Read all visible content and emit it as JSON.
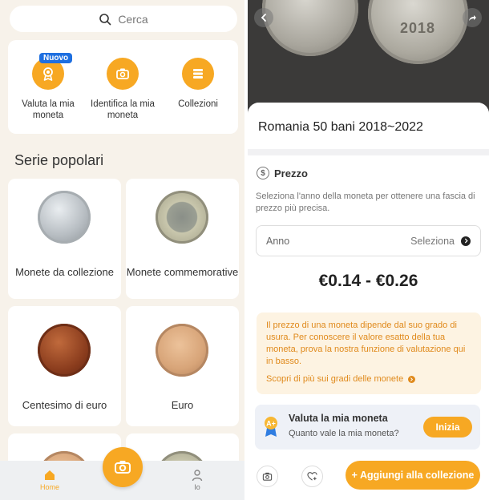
{
  "left_screen": {
    "search": {
      "placeholder": "Cerca",
      "icon": "search-icon"
    },
    "quick_actions": [
      {
        "label": "Valuta la mia moneta",
        "badge": "Nuovo",
        "icon": "medal-icon"
      },
      {
        "label": "Identifica la mia moneta",
        "icon": "camera-icon"
      },
      {
        "label": "Collezioni",
        "icon": "stack-icon"
      }
    ],
    "section_title": "Serie popolari",
    "series": [
      {
        "label": "Monete da collezione"
      },
      {
        "label": "Monete commemorative"
      },
      {
        "label": "Centesimo di euro"
      },
      {
        "label": "Euro"
      }
    ],
    "bottom_nav": {
      "home": "Home",
      "profile": "Io"
    }
  },
  "right_screen": {
    "photo_year_text": "2018",
    "coin_title": "Romania 50 bani 2018~2022",
    "price_section": {
      "heading": "Prezzo",
      "hint": "Seleziona l'anno della moneta per ottenere una fascia di prezzo più precisa.",
      "year_field_label": "Anno",
      "year_field_action": "Seleziona",
      "price_range": "€0.14 - €0.26"
    },
    "note": {
      "text": "Il prezzo di una moneta dipende dal suo grado di usura. Per conoscere il valore esatto della tua moneta, prova la nostra funzione di valutazione qui in basso.",
      "link": "Scopri di più sui gradi delle monete"
    },
    "valuta_card": {
      "title": "Valuta la mia moneta",
      "subtitle": "Quanto vale la mia moneta?",
      "button": "Inizia"
    },
    "actions": {
      "add_button": "+ Aggiungi alla collezione"
    }
  },
  "colors": {
    "accent": "#f7a823",
    "badge_blue": "#1e6fe0",
    "note_bg": "#fdf3e2",
    "note_text": "#e08a1c",
    "left_bg": "#f7f2ea"
  }
}
